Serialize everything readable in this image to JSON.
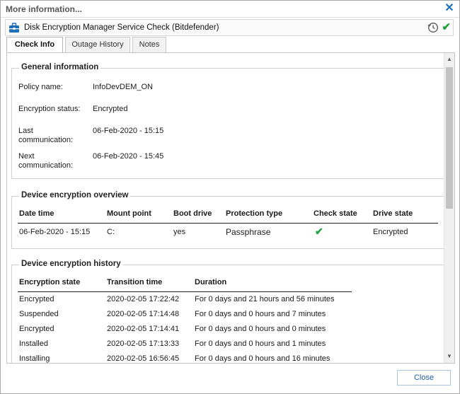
{
  "window": {
    "title": "More information...",
    "close_glyph": "✕"
  },
  "check": {
    "title": "Disk Encryption Manager Service Check (Bitdefender)",
    "status_glyph": "✔",
    "status_color": "#20a040",
    "icons": [
      "briefcase-icon",
      "clock-icon",
      "checkmark-icon"
    ]
  },
  "tabs": [
    {
      "label": "Check Info",
      "active": true
    },
    {
      "label": "Outage History",
      "active": false
    },
    {
      "label": "Notes",
      "active": false
    }
  ],
  "general_information": {
    "title": "General information",
    "fields": [
      {
        "label": "Policy name:",
        "value": "InfoDevDEM_ON"
      },
      {
        "label": "Encryption status:",
        "value": "Encrypted"
      },
      {
        "label_line1": "Last",
        "label_line2": "communication:",
        "value": "06-Feb-2020 - 15:15"
      },
      {
        "label_line1": "Next",
        "label_line2": "communication:",
        "value": "06-Feb-2020 - 15:45"
      }
    ]
  },
  "device_overview": {
    "title": "Device encryption overview",
    "columns": [
      "Date time",
      "Mount point",
      "Boot drive",
      "Protection type",
      "Check state",
      "Drive state"
    ],
    "rows": [
      {
        "date_time": "06-Feb-2020 - 15:15",
        "mount_point": "C:",
        "boot_drive": "yes",
        "protection_type": "Passphrase",
        "check_state": "✔",
        "drive_state": "Encrypted"
      }
    ]
  },
  "device_history": {
    "title": "Device encryption history",
    "columns": [
      "Encryption state",
      "Transition time",
      "Duration"
    ],
    "rows": [
      {
        "state": "Encrypted",
        "time": "2020-02-05 17:22:42",
        "duration": "For 0 days and 21 hours and 56 minutes"
      },
      {
        "state": "Suspended",
        "time": "2020-02-05 17:14:48",
        "duration": "For 0 days and 0 hours and 7 minutes"
      },
      {
        "state": "Encrypted",
        "time": "2020-02-05 17:14:41",
        "duration": "For 0 days and 0 hours and 0 minutes"
      },
      {
        "state": "Installed",
        "time": "2020-02-05 17:13:33",
        "duration": "For 0 days and 0 hours and 1 minutes"
      },
      {
        "state": "Installing",
        "time": "2020-02-05 16:56:45",
        "duration": "For 0 days and 0 hours and 16 minutes"
      }
    ]
  },
  "footer": {
    "close_label": "Close"
  },
  "scrollbar": {
    "up_glyph": "▲",
    "down_glyph": "▼"
  }
}
